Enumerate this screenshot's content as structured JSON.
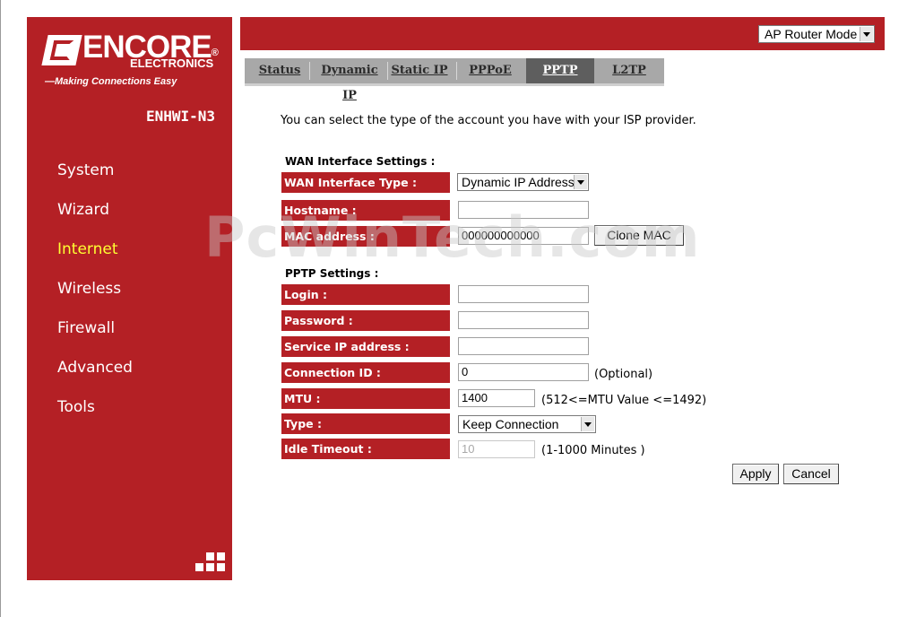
{
  "brand": {
    "name": "ENCORE",
    "sub": "ELECTRONICS",
    "tagline": "—Making Connections Easy",
    "model": "ENHWI-N3"
  },
  "nav": {
    "items": [
      {
        "label": "System"
      },
      {
        "label": "Wizard"
      },
      {
        "label": "Internet"
      },
      {
        "label": "Wireless"
      },
      {
        "label": "Firewall"
      },
      {
        "label": "Advanced"
      },
      {
        "label": "Tools"
      }
    ]
  },
  "header": {
    "mode": "AP Router Mode"
  },
  "tabs": [
    {
      "label": "Status"
    },
    {
      "label": "Dynamic IP"
    },
    {
      "label": "Static IP"
    },
    {
      "label": "PPPoE"
    },
    {
      "label": "PPTP"
    },
    {
      "label": "L2TP"
    }
  ],
  "content": {
    "intro": "You can select the type of the account you have with your ISP provider.",
    "wan_title": "WAN Interface Settings :",
    "wan": {
      "type_label": "WAN Interface Type :",
      "type_value": "Dynamic IP Address",
      "hostname_label": "Hostname :",
      "hostname_value": "",
      "mac_label": "MAC address :",
      "mac_value": "000000000000",
      "clone_mac": "Clone MAC"
    },
    "pptp_title": "PPTP Settings :",
    "pptp": {
      "login_label": "Login :",
      "login_value": "",
      "password_label": "Password :",
      "password_value": "",
      "service_ip_label": "Service IP address :",
      "service_ip_value": "",
      "connection_id_label": "Connection ID :",
      "connection_id_value": "0",
      "connection_id_hint": "(Optional)",
      "mtu_label": "MTU :",
      "mtu_value": "1400",
      "mtu_hint": "(512<=MTU Value <=1492)",
      "type_label": "Type :",
      "type_value": "Keep Connection",
      "idle_label": "Idle Timeout :",
      "idle_value": "10",
      "idle_hint": "(1-1000 Minutes )"
    },
    "apply": "Apply",
    "cancel": "Cancel"
  },
  "watermark": "PcWinTech.com",
  "colors": {
    "brand_red": "#b42025",
    "active_nav": "#ffff33",
    "active_tab": "#5e5e5e"
  }
}
